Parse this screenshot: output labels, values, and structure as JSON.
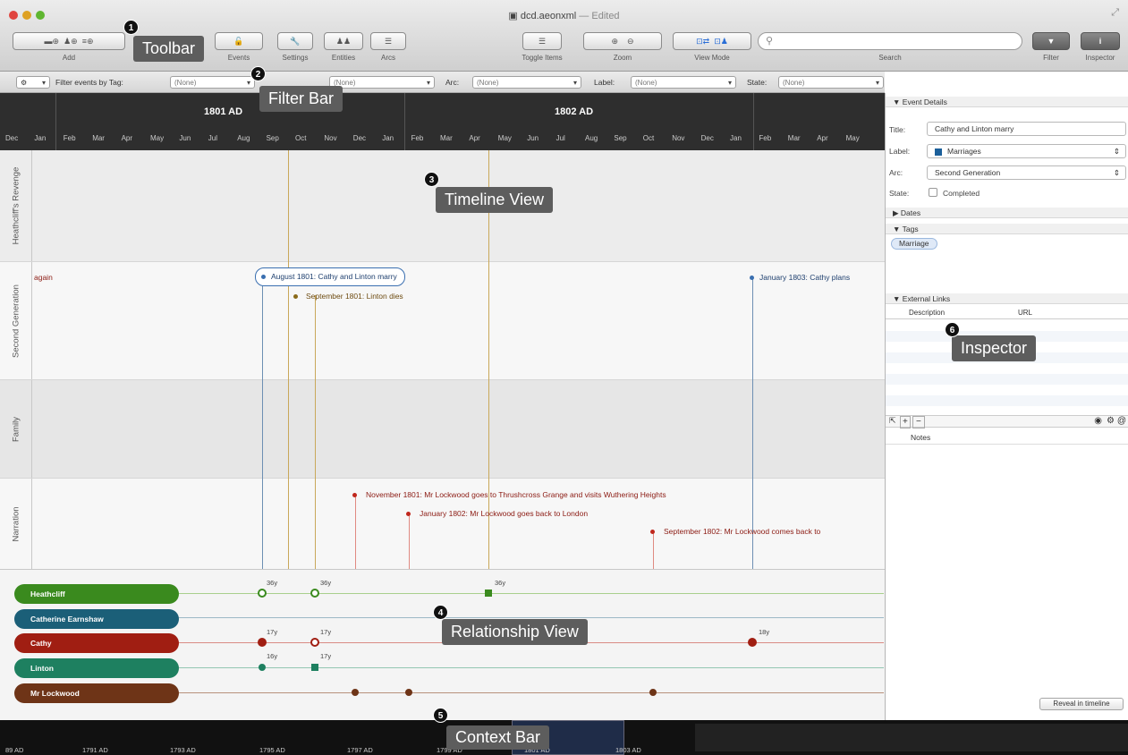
{
  "window": {
    "file": "dcd.aeonxml",
    "edited_suffix": " — Edited"
  },
  "toolbar": {
    "add_label": "Add",
    "events_label": "Events",
    "settings_label": "Settings",
    "entities_label": "Entities",
    "arcs_label": "Arcs",
    "toggle_items_label": "Toggle Items",
    "zoom_label": "Zoom",
    "view_mode_label": "View Mode",
    "search_label": "Search",
    "filter_label": "Filter",
    "inspector_label": "Inspector"
  },
  "filterbar": {
    "filter_by_tag_label": "Filter events by Tag:",
    "tag_value": "(None)",
    "entity_value": "(None)",
    "arc_label": "Arc:",
    "arc_value": "(None)",
    "label_label": "Label:",
    "label_value": "(None)",
    "state_label": "State:",
    "state_value": "(None)"
  },
  "ruler": {
    "years": [
      "1801 AD",
      "1802 AD"
    ],
    "months": [
      "Dec",
      "Jan",
      "Feb",
      "Mar",
      "Apr",
      "May",
      "Jun",
      "Jul",
      "Aug",
      "Sep",
      "Oct",
      "Nov",
      "Dec",
      "Jan",
      "Feb",
      "Mar",
      "Apr",
      "May",
      "Jun",
      "Jul",
      "Aug",
      "Sep",
      "Oct",
      "Nov",
      "Dec",
      "Jan",
      "Feb",
      "Mar",
      "Apr",
      "May"
    ]
  },
  "lanes": [
    "Heathcliff's Revenge",
    "Second Generation",
    "Family",
    "Narration"
  ],
  "events": {
    "e_again": "again",
    "e1": "August 1801: Cathy and Linton marry",
    "e2": "September 1801: Linton dies",
    "e3": "January 1803: Cathy plans",
    "e4": "November 1801: Mr Lockwood goes to Thrushcross Grange and visits Wuthering Heights",
    "e5": "January 1802: Mr Lockwood goes back to London",
    "e6": "September 1802: Mr Lockwood comes back to"
  },
  "entities": [
    {
      "name": "Heathcliff",
      "color": "#3a8a1e"
    },
    {
      "name": "Catherine Earnshaw",
      "color": "#1b5f78"
    },
    {
      "name": "Cathy",
      "color": "#a01e12"
    },
    {
      "name": "Linton",
      "color": "#1e8060"
    },
    {
      "name": "Mr Lockwood",
      "color": "#6e3417"
    }
  ],
  "ages": {
    "h1": "36y",
    "h2": "36y",
    "h3": "36y",
    "c1": "17y",
    "c2": "17y",
    "c3": "18y",
    "l1": "16y",
    "l2": "17y"
  },
  "context": {
    "labels": [
      "89 AD",
      "1791 AD",
      "1793 AD",
      "1795 AD",
      "1797 AD",
      "1799 AD",
      "1801 AD",
      "1803 AD"
    ]
  },
  "inspector": {
    "event_details_header": "Event Details",
    "title_label": "Title:",
    "title_value": "Cathy and Linton marry",
    "label_label": "Label:",
    "label_value": "Marriages",
    "arc_label": "Arc:",
    "arc_value": "Second Generation",
    "state_label": "State:",
    "completed_label": "Completed",
    "dates_header": "Dates",
    "tags_header": "Tags",
    "tag": "Marriage",
    "links_header": "External Links",
    "col_description": "Description",
    "col_url": "URL",
    "notes_label": "Notes",
    "reveal_button": "Reveal in timeline"
  },
  "callouts": {
    "toolbar": "Toolbar",
    "filter": "Filter Bar",
    "timeline": "Timeline View",
    "relationship": "Relationship View",
    "context": "Context Bar",
    "inspector": "Inspector"
  },
  "callout_numbers": [
    "1",
    "2",
    "3",
    "4",
    "5",
    "6"
  ]
}
